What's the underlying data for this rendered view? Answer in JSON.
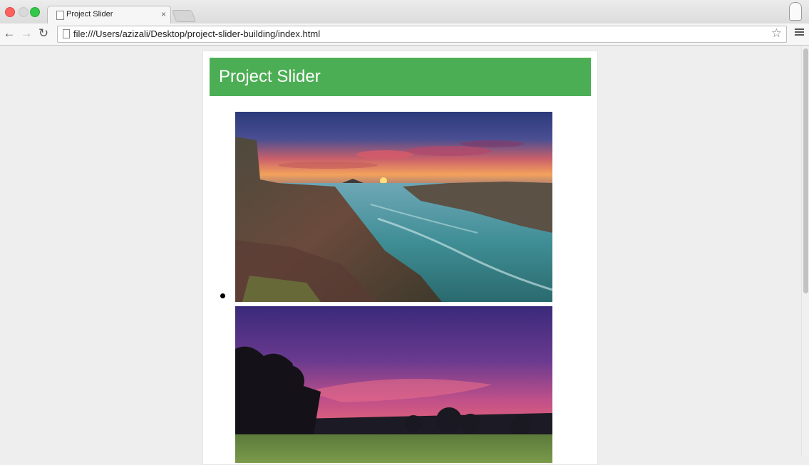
{
  "browser": {
    "tab_title": "Project Slider",
    "tab_close": "×",
    "url": "file:///Users/azizali/Desktop/project-slider-building/index.html"
  },
  "page": {
    "header_title": "Project Slider",
    "header_color": "#4cae54"
  },
  "slides": [
    {
      "name": "coastal-sunset-rocks-image"
    },
    {
      "name": "purple-sky-trees-field-image"
    }
  ]
}
